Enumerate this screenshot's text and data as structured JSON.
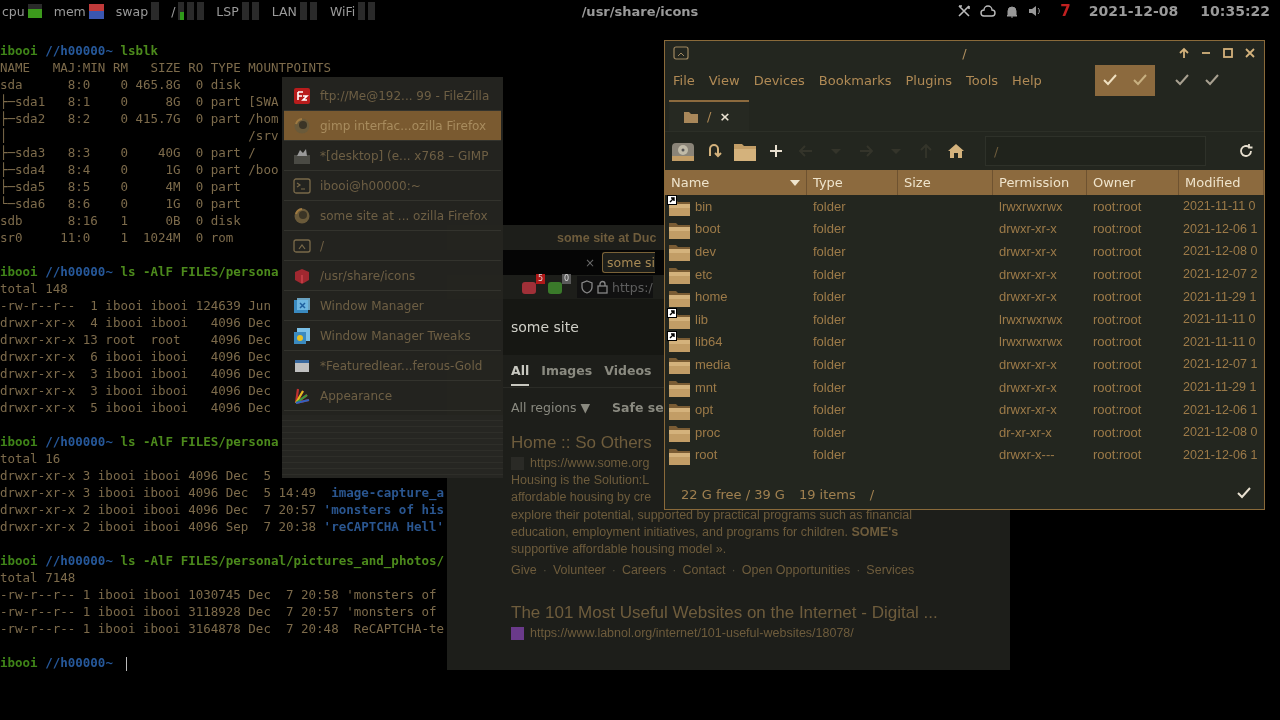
{
  "top_bar": {
    "meters": [
      {
        "label": "cpu",
        "kind": "load"
      },
      {
        "label": "mem",
        "kind": "memory"
      },
      {
        "label": "swap",
        "kind": "bar1"
      },
      {
        "label": "/",
        "kind": "bar3"
      },
      {
        "label": "LSP",
        "kind": "bar2"
      },
      {
        "label": "LAN",
        "kind": "bar2"
      },
      {
        "label": "WiFi",
        "kind": "bar2"
      }
    ],
    "title": "/usr/share/icons",
    "badge": "7",
    "date": "2021-12-08",
    "time": "10:35:22"
  },
  "terminal": {
    "lines": [
      {
        "kind": "prompt",
        "user": "ibooi",
        "host": "//h00000~",
        "command": "lsblk"
      },
      {
        "kind": "output",
        "text": "NAME   MAJ:MIN RM   SIZE RO TYPE MOUNTPOINTS"
      },
      {
        "kind": "output",
        "text": "sda      8:0    0 465.8G  0 disk"
      },
      {
        "kind": "output",
        "text": "├─sda1   8:1    0     8G  0 part [SWA"
      },
      {
        "kind": "output",
        "text": "├─sda2   8:2    0 415.7G  0 part /hom"
      },
      {
        "kind": "output",
        "text": "│                                /srv"
      },
      {
        "kind": "output",
        "text": "├─sda3   8:3    0    40G  0 part /"
      },
      {
        "kind": "output",
        "text": "├─sda4   8:4    0     1G  0 part /boo"
      },
      {
        "kind": "output",
        "text": "├─sda5   8:5    0     4M  0 part"
      },
      {
        "kind": "output",
        "text": "└─sda6   8:6    0     1G  0 part"
      },
      {
        "kind": "output",
        "text": "sdb      8:16   1     0B  0 disk"
      },
      {
        "kind": "output",
        "text": "sr0     11:0    1  1024M  0 rom"
      },
      {
        "kind": "blank"
      },
      {
        "kind": "prompt",
        "user": "ibooi",
        "host": "//h00000~",
        "command": "ls -AlF FILES/persona"
      },
      {
        "kind": "output",
        "text": "total 148"
      },
      {
        "kind": "output",
        "text": "-rw-r--r--  1 ibooi ibooi 124639 Jun"
      },
      {
        "kind": "output",
        "text": "drwxr-xr-x  4 ibooi ibooi   4096 Dec"
      },
      {
        "kind": "output",
        "text": "drwxr-xr-x 13 root  root    4096 Dec"
      },
      {
        "kind": "output",
        "text": "drwxr-xr-x  6 ibooi ibooi   4096 Dec"
      },
      {
        "kind": "output",
        "text": "drwxr-xr-x  3 ibooi ibooi   4096 Dec"
      },
      {
        "kind": "output",
        "text": "drwxr-xr-x  3 ibooi ibooi   4096 Dec"
      },
      {
        "kind": "output",
        "text": "drwxr-xr-x  5 ibooi ibooi   4096 Dec"
      },
      {
        "kind": "blank"
      },
      {
        "kind": "prompt",
        "user": "ibooi",
        "host": "//h00000~",
        "command": "ls -AlF FILES/persona"
      },
      {
        "kind": "output",
        "text": "total 16"
      },
      {
        "kind": "output",
        "text": "drwxr-xr-x 3 ibooi ibooi 4096 Dec  5"
      },
      {
        "kind": "output",
        "text": "drwxr-xr-x 3 ibooi ibooi 4096 Dec  5 14:49  ",
        "name": "image-capture_a"
      },
      {
        "kind": "output",
        "text": "drwxr-xr-x 2 ibooi ibooi 4096 Dec  7 20:57 ",
        "name": "'monsters of his"
      },
      {
        "kind": "output",
        "text": "drwxr-xr-x 2 ibooi ibooi 4096 Sep  7 20:38 ",
        "name": "'reCAPTCHA Hell'"
      },
      {
        "kind": "blank"
      },
      {
        "kind": "prompt",
        "user": "ibooi",
        "host": "//h00000~",
        "command": "ls -AlF FILES/personal/pictures_and_photos/"
      },
      {
        "kind": "output",
        "text": "total 7148"
      },
      {
        "kind": "output",
        "text": "-rw-r--r-- 1 ibooi ibooi 1030745 Dec  7 20:58 'monsters of"
      },
      {
        "kind": "output",
        "text": "-rw-r--r-- 1 ibooi ibooi 3118928 Dec  7 20:57 'monsters of"
      },
      {
        "kind": "output",
        "text": "-rw-r--r-- 1 ibooi ibooi 3164878 Dec  7 20:48  ReCAPTCHA-te"
      },
      {
        "kind": "blank"
      },
      {
        "kind": "prompt",
        "user": "ibooi",
        "host": "//h00000~",
        "cursor": true
      }
    ]
  },
  "switcher": {
    "items": [
      {
        "title": "ftp://Me@192... 99 - FileZilla",
        "selected": false
      },
      {
        "title": "gimp interfac...ozilla Firefox",
        "selected": true
      },
      {
        "title": "*[desktop] (e... x768 – GIMP",
        "selected": false
      },
      {
        "title": "ibooi@h00000:~",
        "selected": false
      },
      {
        "title": "some site at ... ozilla Firefox",
        "selected": false
      },
      {
        "title": "/",
        "selected": false
      },
      {
        "title": "/usr/share/icons",
        "selected": false
      },
      {
        "title": "Window Manager",
        "selected": false
      },
      {
        "title": "Window Manager Tweaks",
        "selected": false
      },
      {
        "title": "*FeaturedIear...ferous-Gold",
        "selected": false
      },
      {
        "title": "Appearance",
        "selected": false
      }
    ]
  },
  "browser": {
    "title": "some site at Duc",
    "tabs": [
      {
        "close": "×",
        "selected": false
      },
      {
        "label": "some si",
        "selected": true
      }
    ],
    "extensions": [
      {
        "badge": "5",
        "color": "#b01818"
      },
      {
        "badge": "0",
        "color": "#5a5a5a"
      }
    ],
    "address": "https:/",
    "search": "some site",
    "nav": [
      {
        "label": "All",
        "selected": true
      },
      {
        "label": "Images",
        "selected": false
      },
      {
        "label": "Videos",
        "selected": false
      }
    ],
    "filters": [
      "All regions ▼",
      "Safe se"
    ],
    "results": [
      {
        "title": "Home :: So Others",
        "url": "https://www.some.org",
        "snippet": [
          "Housing is the Solution:L",
          "affordable housing by cre",
          "explore their potential, supported by practical programs such as financial",
          "education, employment initiatives, and programs for children. **SOME's**",
          "supportive affordable housing model »."
        ],
        "links": [
          "Give",
          "Volunteer",
          "Careers",
          "Contact",
          "Open Opportunities",
          "Services"
        ],
        "link_separator": "·"
      },
      {
        "title": "The 101 Most Useful Websites on the Internet - Digital ...",
        "url": "https://www.labnol.org/internet/101-useful-websites/18078/"
      }
    ]
  },
  "file_manager": {
    "title": "/",
    "menu": [
      "File",
      "View",
      "Devices",
      "Bookmarks",
      "Plugins",
      "Tools",
      "Help"
    ],
    "toggles": [
      {
        "on": true
      },
      {
        "on": true
      },
      {
        "on": false
      },
      {
        "on": false
      }
    ],
    "tab": {
      "label": "/",
      "close": "×"
    },
    "toolbar": [
      {
        "disabled": false
      },
      {
        "disabled": false
      },
      {
        "disabled": false
      },
      {
        "disabled": false
      },
      {
        "disabled": true
      },
      {
        "disabled": true
      },
      {
        "disabled": true
      },
      {
        "disabled": true
      },
      {
        "disabled": true
      },
      {
        "disabled": false
      }
    ],
    "path": "/",
    "columns": [
      "Name",
      "Type",
      "Size",
      "Permission",
      "Owner",
      "Modified"
    ],
    "rows": [
      {
        "name": "bin",
        "type": "folder",
        "permission": "lrwxrwxrwx",
        "owner": "root:root",
        "modified": "2021-11-11 0",
        "link": true
      },
      {
        "name": "boot",
        "type": "folder",
        "permission": "drwxr-xr-x",
        "owner": "root:root",
        "modified": "2021-12-06 1",
        "link": false
      },
      {
        "name": "dev",
        "type": "folder",
        "permission": "drwxr-xr-x",
        "owner": "root:root",
        "modified": "2021-12-08 0",
        "link": false
      },
      {
        "name": "etc",
        "type": "folder",
        "permission": "drwxr-xr-x",
        "owner": "root:root",
        "modified": "2021-12-07 2",
        "link": false
      },
      {
        "name": "home",
        "type": "folder",
        "permission": "drwxr-xr-x",
        "owner": "root:root",
        "modified": "2021-11-29 1",
        "link": false
      },
      {
        "name": "lib",
        "type": "folder",
        "permission": "lrwxrwxrwx",
        "owner": "root:root",
        "modified": "2021-11-11 0",
        "link": true
      },
      {
        "name": "lib64",
        "type": "folder",
        "permission": "lrwxrwxrwx",
        "owner": "root:root",
        "modified": "2021-11-11 0",
        "link": true
      },
      {
        "name": "media",
        "type": "folder",
        "permission": "drwxr-xr-x",
        "owner": "root:root",
        "modified": "2021-12-07 1",
        "link": false
      },
      {
        "name": "mnt",
        "type": "folder",
        "permission": "drwxr-xr-x",
        "owner": "root:root",
        "modified": "2021-11-29 1",
        "link": false
      },
      {
        "name": "opt",
        "type": "folder",
        "permission": "drwxr-xr-x",
        "owner": "root:root",
        "modified": "2021-12-06 1",
        "link": false
      },
      {
        "name": "proc",
        "type": "folder",
        "permission": "dr-xr-xr-x",
        "owner": "root:root",
        "modified": "2021-12-08 0",
        "link": false
      },
      {
        "name": "root",
        "type": "folder",
        "permission": "drwxr-x---",
        "owner": "root:root",
        "modified": "2021-12-06 1",
        "link": false
      }
    ],
    "status": {
      "free": "22 G free / 39 G",
      "items": "19 items",
      "path": "/"
    }
  }
}
